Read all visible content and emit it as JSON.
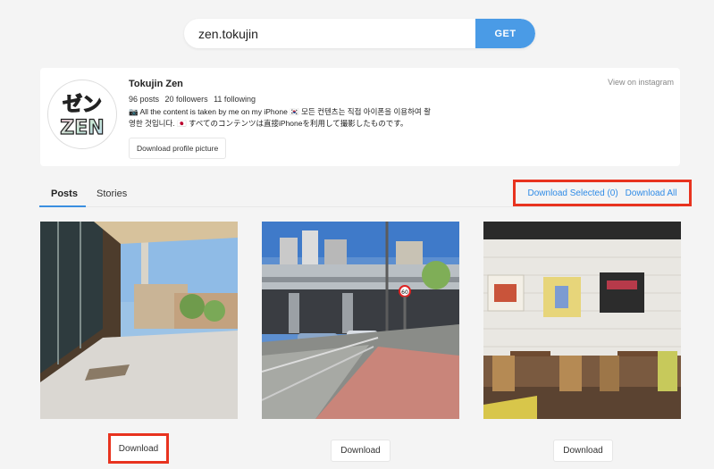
{
  "search": {
    "value": "zen.tokujin",
    "button": "GET"
  },
  "profile": {
    "name": "Tokujin Zen",
    "posts": "96 posts",
    "followers": "20 followers",
    "following": "11 following",
    "bio_line1": "📷 All the content is taken by me on my iPhone 🇰🇷 모든 컨텐츠는 직접 아이폰을 이용하여 촬",
    "bio_line2": "영한 것입니다. 🇯🇵 すべてのコンテンツは直接iPhoneを利用して撮影したものです。",
    "download_picture": "Download profile picture",
    "view_on_instagram": "View on instagram"
  },
  "tabs": [
    {
      "label": "Posts",
      "active": true
    },
    {
      "label": "Stories",
      "active": false
    }
  ],
  "actions": {
    "download_selected": "Download Selected (0)",
    "download_all": "Download All"
  },
  "posts": [
    {
      "download": "Download",
      "highlighted": true
    },
    {
      "download": "Download",
      "highlighted": false
    },
    {
      "download": "Download",
      "highlighted": false
    }
  ],
  "colors": {
    "accent": "#4a9be6",
    "link": "#2f8be6",
    "highlight": "#e8331f",
    "background": "#f4f4f4"
  }
}
